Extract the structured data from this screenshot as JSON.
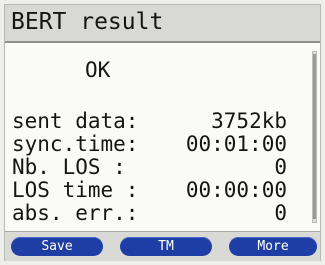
{
  "window": {
    "title": "BERT result"
  },
  "result": {
    "status": "OK",
    "rows": [
      {
        "label": "sent data:",
        "value": "3752kb"
      },
      {
        "label": "sync.time:",
        "value": "00:01:00"
      },
      {
        "label": "Nb. LOS   :",
        "value": "0"
      },
      {
        "label": "LOS time :",
        "value": "00:00:00"
      },
      {
        "label": "abs. err.:",
        "value": "0"
      }
    ]
  },
  "softkeys": {
    "save_label": "Save",
    "tm_label": "TM",
    "more_label": "More"
  },
  "colors": {
    "softkey_background": "#1f3ea5",
    "title_background": "#d8d8d5",
    "screen_background": "#fafaf8"
  }
}
